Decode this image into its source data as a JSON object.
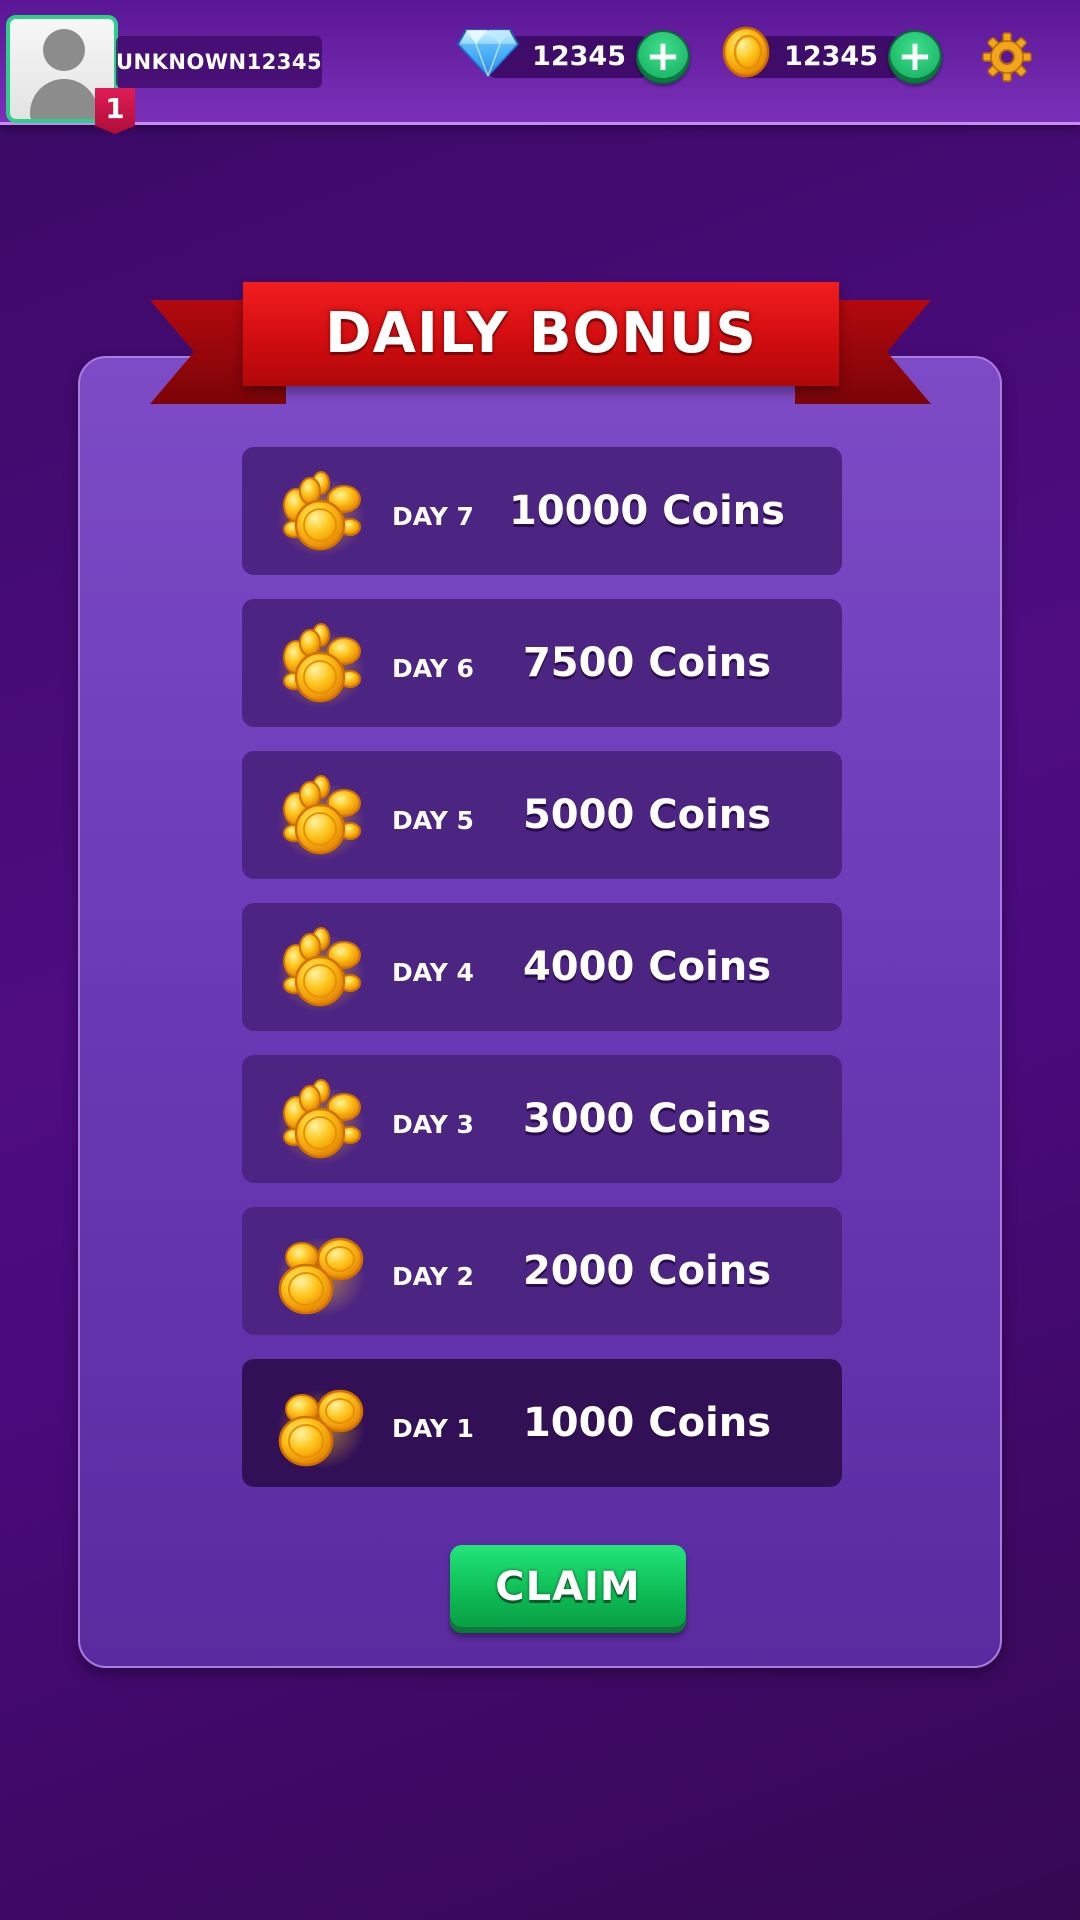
{
  "profile": {
    "username": "UNKNOWN12345",
    "level": "1",
    "avatar_icon": "user-silhouette-icon"
  },
  "currencies": {
    "gems": {
      "amount": "12345",
      "icon": "diamond-icon"
    },
    "coins": {
      "amount": "12345",
      "icon": "gold-coin-icon"
    }
  },
  "settings_icon": "gear-icon",
  "dialog": {
    "title": "DAILY BONUS",
    "claim_label": "CLAIM"
  },
  "rewards": [
    {
      "day": "DAY 7",
      "amount": "10000 Coins",
      "icon": "coin-pile-icon"
    },
    {
      "day": "DAY 6",
      "amount": "7500 Coins",
      "icon": "coin-pile-icon"
    },
    {
      "day": "DAY 5",
      "amount": "5000 Coins",
      "icon": "coin-pile-icon"
    },
    {
      "day": "DAY 4",
      "amount": "4000 Coins",
      "icon": "coin-pile-icon"
    },
    {
      "day": "DAY 3",
      "amount": "3000 Coins",
      "icon": "coin-pile-icon"
    },
    {
      "day": "DAY 2",
      "amount": "2000 Coins",
      "icon": "coin-pair-icon"
    },
    {
      "day": "DAY 1",
      "amount": "1000 Coins",
      "icon": "coin-pair-icon",
      "current": true
    }
  ],
  "colors": {
    "background": "#4e0c80",
    "panel": "#6b3bb8",
    "row": "#4c2482",
    "row_current": "#321056",
    "ribbon": "#d10d10",
    "claim": "#0cb852",
    "plus_button": "#1cc06e",
    "gold": "#f5b400"
  }
}
